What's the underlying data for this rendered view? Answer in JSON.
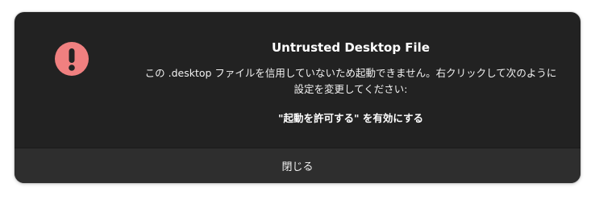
{
  "dialog": {
    "title": "Untrusted Desktop File",
    "body_line_1": "この .desktop ファイルを信用していないため起動できません。右クリックして次のように",
    "body_line_2": "設定を変更してください:",
    "instruction": "\"起動を許可する\" を有効にする",
    "icon": "dialog-warning-icon",
    "close_button_label": "閉じる"
  },
  "colors": {
    "dialog_background": "#222222",
    "footer_background": "#2e2e2e",
    "warning_icon": "#f08080"
  }
}
